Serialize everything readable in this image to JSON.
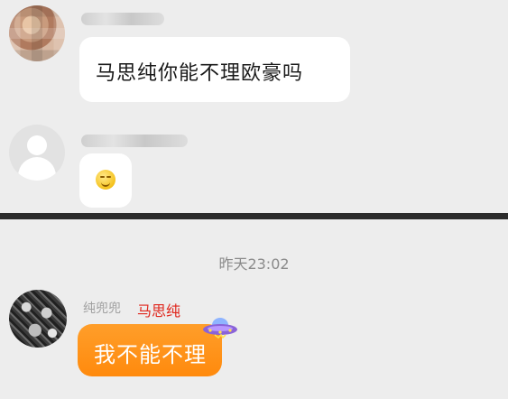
{
  "chat_top": {
    "message_1": {
      "text": "马思纯你能不理欧豪吗"
    }
  },
  "chat_bottom": {
    "timestamp": "昨天23:02",
    "reply": {
      "nickname": "纯兜兜",
      "annotation": "马思纯",
      "annotation_color": "#e0281e",
      "text": "我不能不理",
      "bubble_color": "#ff8a0d"
    }
  },
  "icons": [
    "user-avatar-icon",
    "smile-emoji-icon",
    "ufo-badge-icon"
  ]
}
